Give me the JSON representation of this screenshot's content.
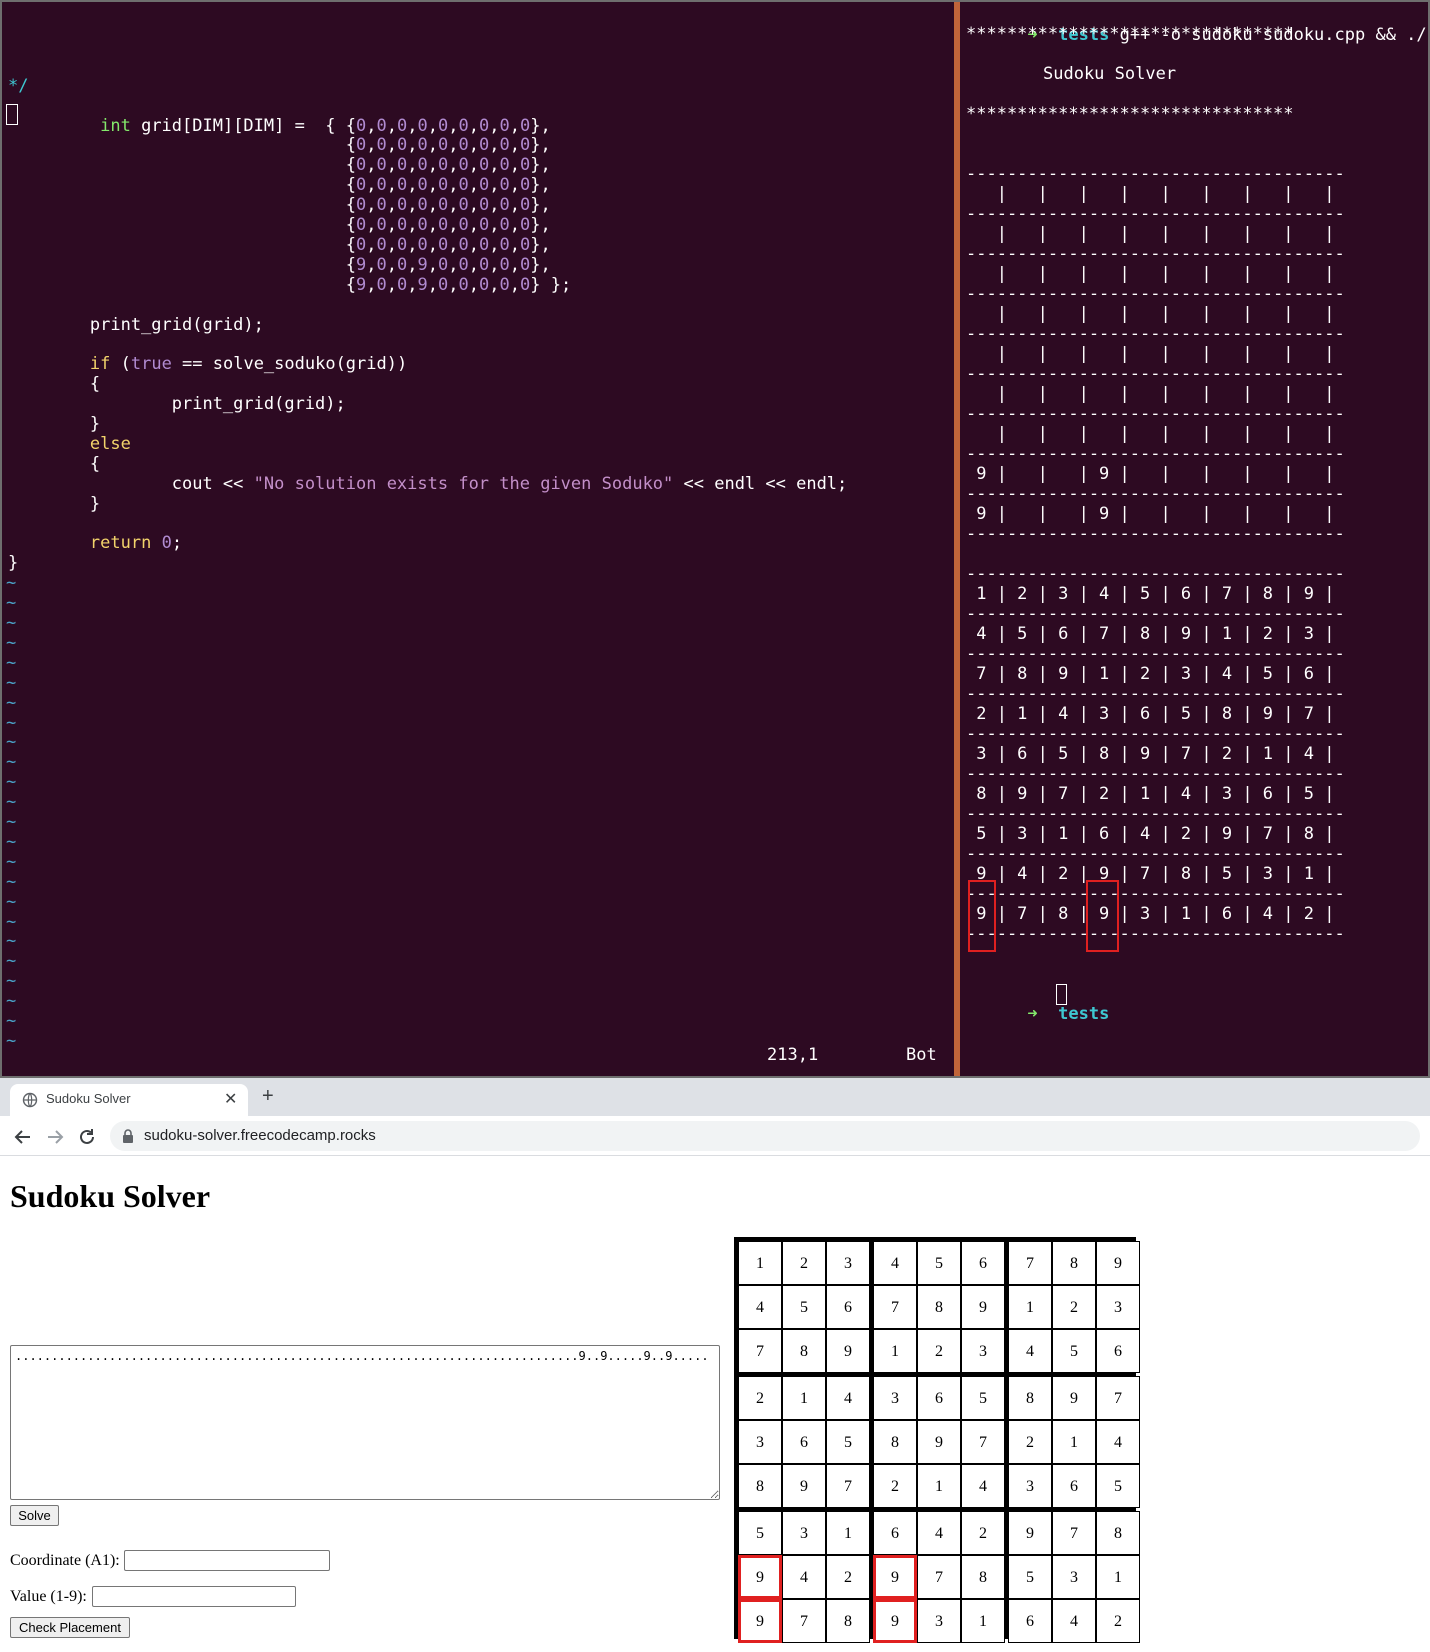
{
  "vim": {
    "lines": [
      [
        {
          "t": "",
          "c": ""
        }
      ],
      [
        {
          "t": "",
          "c": ""
        }
      ],
      [
        {
          "t": "",
          "c": ""
        }
      ],
      [
        {
          "t": "*/",
          "c": "c-cyan"
        }
      ],
      [
        {
          "t": "",
          "c": ""
        }
      ],
      [
        {
          "t": "         ",
          "c": ""
        },
        {
          "t": "int",
          "c": "c-green"
        },
        {
          "t": " grid[DIM][DIM] =  { {",
          "c": ""
        },
        {
          "t": "0",
          "c": "c-num"
        },
        {
          "t": ",",
          "c": ""
        },
        {
          "t": "0",
          "c": "c-num"
        },
        {
          "t": ",",
          "c": ""
        },
        {
          "t": "0",
          "c": "c-num"
        },
        {
          "t": ",",
          "c": ""
        },
        {
          "t": "0",
          "c": "c-num"
        },
        {
          "t": ",",
          "c": ""
        },
        {
          "t": "0",
          "c": "c-num"
        },
        {
          "t": ",",
          "c": ""
        },
        {
          "t": "0",
          "c": "c-num"
        },
        {
          "t": ",",
          "c": ""
        },
        {
          "t": "0",
          "c": "c-num"
        },
        {
          "t": ",",
          "c": ""
        },
        {
          "t": "0",
          "c": "c-num"
        },
        {
          "t": ",",
          "c": ""
        },
        {
          "t": "0",
          "c": "c-num"
        },
        {
          "t": "},",
          "c": ""
        }
      ],
      [
        {
          "t": "                                 {",
          "c": ""
        },
        {
          "t": "0",
          "c": "c-num"
        },
        {
          "t": ",",
          "c": ""
        },
        {
          "t": "0",
          "c": "c-num"
        },
        {
          "t": ",",
          "c": ""
        },
        {
          "t": "0",
          "c": "c-num"
        },
        {
          "t": ",",
          "c": ""
        },
        {
          "t": "0",
          "c": "c-num"
        },
        {
          "t": ",",
          "c": ""
        },
        {
          "t": "0",
          "c": "c-num"
        },
        {
          "t": ",",
          "c": ""
        },
        {
          "t": "0",
          "c": "c-num"
        },
        {
          "t": ",",
          "c": ""
        },
        {
          "t": "0",
          "c": "c-num"
        },
        {
          "t": ",",
          "c": ""
        },
        {
          "t": "0",
          "c": "c-num"
        },
        {
          "t": ",",
          "c": ""
        },
        {
          "t": "0",
          "c": "c-num"
        },
        {
          "t": "},",
          "c": ""
        }
      ],
      [
        {
          "t": "                                 {",
          "c": ""
        },
        {
          "t": "0",
          "c": "c-num"
        },
        {
          "t": ",",
          "c": ""
        },
        {
          "t": "0",
          "c": "c-num"
        },
        {
          "t": ",",
          "c": ""
        },
        {
          "t": "0",
          "c": "c-num"
        },
        {
          "t": ",",
          "c": ""
        },
        {
          "t": "0",
          "c": "c-num"
        },
        {
          "t": ",",
          "c": ""
        },
        {
          "t": "0",
          "c": "c-num"
        },
        {
          "t": ",",
          "c": ""
        },
        {
          "t": "0",
          "c": "c-num"
        },
        {
          "t": ",",
          "c": ""
        },
        {
          "t": "0",
          "c": "c-num"
        },
        {
          "t": ",",
          "c": ""
        },
        {
          "t": "0",
          "c": "c-num"
        },
        {
          "t": ",",
          "c": ""
        },
        {
          "t": "0",
          "c": "c-num"
        },
        {
          "t": "},",
          "c": ""
        }
      ],
      [
        {
          "t": "                                 {",
          "c": ""
        },
        {
          "t": "0",
          "c": "c-num"
        },
        {
          "t": ",",
          "c": ""
        },
        {
          "t": "0",
          "c": "c-num"
        },
        {
          "t": ",",
          "c": ""
        },
        {
          "t": "0",
          "c": "c-num"
        },
        {
          "t": ",",
          "c": ""
        },
        {
          "t": "0",
          "c": "c-num"
        },
        {
          "t": ",",
          "c": ""
        },
        {
          "t": "0",
          "c": "c-num"
        },
        {
          "t": ",",
          "c": ""
        },
        {
          "t": "0",
          "c": "c-num"
        },
        {
          "t": ",",
          "c": ""
        },
        {
          "t": "0",
          "c": "c-num"
        },
        {
          "t": ",",
          "c": ""
        },
        {
          "t": "0",
          "c": "c-num"
        },
        {
          "t": ",",
          "c": ""
        },
        {
          "t": "0",
          "c": "c-num"
        },
        {
          "t": "},",
          "c": ""
        }
      ],
      [
        {
          "t": "                                 {",
          "c": ""
        },
        {
          "t": "0",
          "c": "c-num"
        },
        {
          "t": ",",
          "c": ""
        },
        {
          "t": "0",
          "c": "c-num"
        },
        {
          "t": ",",
          "c": ""
        },
        {
          "t": "0",
          "c": "c-num"
        },
        {
          "t": ",",
          "c": ""
        },
        {
          "t": "0",
          "c": "c-num"
        },
        {
          "t": ",",
          "c": ""
        },
        {
          "t": "0",
          "c": "c-num"
        },
        {
          "t": ",",
          "c": ""
        },
        {
          "t": "0",
          "c": "c-num"
        },
        {
          "t": ",",
          "c": ""
        },
        {
          "t": "0",
          "c": "c-num"
        },
        {
          "t": ",",
          "c": ""
        },
        {
          "t": "0",
          "c": "c-num"
        },
        {
          "t": ",",
          "c": ""
        },
        {
          "t": "0",
          "c": "c-num"
        },
        {
          "t": "},",
          "c": ""
        }
      ],
      [
        {
          "t": "                                 {",
          "c": ""
        },
        {
          "t": "0",
          "c": "c-num"
        },
        {
          "t": ",",
          "c": ""
        },
        {
          "t": "0",
          "c": "c-num"
        },
        {
          "t": ",",
          "c": ""
        },
        {
          "t": "0",
          "c": "c-num"
        },
        {
          "t": ",",
          "c": ""
        },
        {
          "t": "0",
          "c": "c-num"
        },
        {
          "t": ",",
          "c": ""
        },
        {
          "t": "0",
          "c": "c-num"
        },
        {
          "t": ",",
          "c": ""
        },
        {
          "t": "0",
          "c": "c-num"
        },
        {
          "t": ",",
          "c": ""
        },
        {
          "t": "0",
          "c": "c-num"
        },
        {
          "t": ",",
          "c": ""
        },
        {
          "t": "0",
          "c": "c-num"
        },
        {
          "t": ",",
          "c": ""
        },
        {
          "t": "0",
          "c": "c-num"
        },
        {
          "t": "},",
          "c": ""
        }
      ],
      [
        {
          "t": "                                 {",
          "c": ""
        },
        {
          "t": "0",
          "c": "c-num"
        },
        {
          "t": ",",
          "c": ""
        },
        {
          "t": "0",
          "c": "c-num"
        },
        {
          "t": ",",
          "c": ""
        },
        {
          "t": "0",
          "c": "c-num"
        },
        {
          "t": ",",
          "c": ""
        },
        {
          "t": "0",
          "c": "c-num"
        },
        {
          "t": ",",
          "c": ""
        },
        {
          "t": "0",
          "c": "c-num"
        },
        {
          "t": ",",
          "c": ""
        },
        {
          "t": "0",
          "c": "c-num"
        },
        {
          "t": ",",
          "c": ""
        },
        {
          "t": "0",
          "c": "c-num"
        },
        {
          "t": ",",
          "c": ""
        },
        {
          "t": "0",
          "c": "c-num"
        },
        {
          "t": ",",
          "c": ""
        },
        {
          "t": "0",
          "c": "c-num"
        },
        {
          "t": "},",
          "c": ""
        }
      ],
      [
        {
          "t": "                                 {",
          "c": ""
        },
        {
          "t": "9",
          "c": "c-num"
        },
        {
          "t": ",",
          "c": ""
        },
        {
          "t": "0",
          "c": "c-num"
        },
        {
          "t": ",",
          "c": ""
        },
        {
          "t": "0",
          "c": "c-num"
        },
        {
          "t": ",",
          "c": ""
        },
        {
          "t": "9",
          "c": "c-num"
        },
        {
          "t": ",",
          "c": ""
        },
        {
          "t": "0",
          "c": "c-num"
        },
        {
          "t": ",",
          "c": ""
        },
        {
          "t": "0",
          "c": "c-num"
        },
        {
          "t": ",",
          "c": ""
        },
        {
          "t": "0",
          "c": "c-num"
        },
        {
          "t": ",",
          "c": ""
        },
        {
          "t": "0",
          "c": "c-num"
        },
        {
          "t": ",",
          "c": ""
        },
        {
          "t": "0",
          "c": "c-num"
        },
        {
          "t": "},",
          "c": ""
        }
      ],
      [
        {
          "t": "                                 {",
          "c": ""
        },
        {
          "t": "9",
          "c": "c-num"
        },
        {
          "t": ",",
          "c": ""
        },
        {
          "t": "0",
          "c": "c-num"
        },
        {
          "t": ",",
          "c": ""
        },
        {
          "t": "0",
          "c": "c-num"
        },
        {
          "t": ",",
          "c": ""
        },
        {
          "t": "9",
          "c": "c-num"
        },
        {
          "t": ",",
          "c": ""
        },
        {
          "t": "0",
          "c": "c-num"
        },
        {
          "t": ",",
          "c": ""
        },
        {
          "t": "0",
          "c": "c-num"
        },
        {
          "t": ",",
          "c": ""
        },
        {
          "t": "0",
          "c": "c-num"
        },
        {
          "t": ",",
          "c": ""
        },
        {
          "t": "0",
          "c": "c-num"
        },
        {
          "t": ",",
          "c": ""
        },
        {
          "t": "0",
          "c": "c-num"
        },
        {
          "t": "} };",
          "c": ""
        }
      ],
      [
        {
          "t": "",
          "c": ""
        }
      ],
      [
        {
          "t": "        print_grid(grid);",
          "c": ""
        }
      ],
      [
        {
          "t": "",
          "c": ""
        }
      ],
      [
        {
          "t": "        ",
          "c": ""
        },
        {
          "t": "if",
          "c": "c-yellow"
        },
        {
          "t": " (",
          "c": ""
        },
        {
          "t": "true",
          "c": "c-num"
        },
        {
          "t": " == solve_soduko(grid))",
          "c": ""
        }
      ],
      [
        {
          "t": "        {",
          "c": ""
        }
      ],
      [
        {
          "t": "                print_grid(grid);",
          "c": ""
        }
      ],
      [
        {
          "t": "        }",
          "c": ""
        }
      ],
      [
        {
          "t": "        ",
          "c": ""
        },
        {
          "t": "else",
          "c": "c-yellow"
        }
      ],
      [
        {
          "t": "        {",
          "c": ""
        }
      ],
      [
        {
          "t": "                cout << ",
          "c": ""
        },
        {
          "t": "\"No solution exists for the given Soduko\"",
          "c": "c-str"
        },
        {
          "t": " << endl << endl;",
          "c": ""
        }
      ],
      [
        {
          "t": "        }",
          "c": ""
        }
      ],
      [
        {
          "t": "",
          "c": ""
        }
      ],
      [
        {
          "t": "        ",
          "c": ""
        },
        {
          "t": "return",
          "c": "c-yellow"
        },
        {
          "t": " ",
          "c": ""
        },
        {
          "t": "0",
          "c": "c-num"
        },
        {
          "t": ";",
          "c": ""
        }
      ],
      [
        {
          "t": "}",
          "c": ""
        }
      ]
    ],
    "tilde": "~",
    "tilde_count": 24,
    "status_position": "213,1",
    "status_scroll": "Bot"
  },
  "shell": {
    "prompt_arrow": "➜",
    "prompt_dir": "tests",
    "command": "g++ -o sudoku sudoku.cpp && ./sudoku",
    "stars": "********************************",
    "banner": "Sudoku Solver",
    "separator": "-------------------------------------",
    "input_rows": [
      "   |   |   |   |   |   |   |   |   |",
      "   |   |   |   |   |   |   |   |   |",
      "   |   |   |   |   |   |   |   |   |",
      "   |   |   |   |   |   |   |   |   |",
      "   |   |   |   |   |   |   |   |   |",
      "   |   |   |   |   |   |   |   |   |",
      "   |   |   |   |   |   |   |   |   |",
      " 9 |   |   | 9 |   |   |   |   |   |",
      " 9 |   |   | 9 |   |   |   |   |   |"
    ],
    "solved_rows": [
      " 1 | 2 | 3 | 4 | 5 | 6 | 7 | 8 | 9 |",
      " 4 | 5 | 6 | 7 | 8 | 9 | 1 | 2 | 3 |",
      " 7 | 8 | 9 | 1 | 2 | 3 | 4 | 5 | 6 |",
      " 2 | 1 | 4 | 3 | 6 | 5 | 8 | 9 | 7 |",
      " 3 | 6 | 5 | 8 | 9 | 7 | 2 | 1 | 4 |",
      " 8 | 9 | 7 | 2 | 1 | 4 | 3 | 6 | 5 |",
      " 5 | 3 | 1 | 6 | 4 | 2 | 9 | 7 | 8 |",
      " 9 | 4 | 2 | 9 | 7 | 8 | 5 | 3 | 1 |",
      " 9 | 7 | 8 | 9 | 3 | 1 | 6 | 4 | 2 |"
    ]
  },
  "browser": {
    "tab_title": "Sudoku Solver",
    "tab_close": "✕",
    "new_tab": "+",
    "url": "sudoku-solver.freecodecamp.rocks",
    "page_title": "Sudoku Solver",
    "puzzle_string": "..............................................................................9..9.....9..9.....",
    "solve_label": "Solve",
    "coordinate_label": "Coordinate (A1):",
    "value_label": "Value (1-9):",
    "check_label": "Check Placement",
    "grid": [
      [
        1,
        2,
        3,
        4,
        5,
        6,
        7,
        8,
        9
      ],
      [
        4,
        5,
        6,
        7,
        8,
        9,
        1,
        2,
        3
      ],
      [
        7,
        8,
        9,
        1,
        2,
        3,
        4,
        5,
        6
      ],
      [
        2,
        1,
        4,
        3,
        6,
        5,
        8,
        9,
        7
      ],
      [
        3,
        6,
        5,
        8,
        9,
        7,
        2,
        1,
        4
      ],
      [
        8,
        9,
        7,
        2,
        1,
        4,
        3,
        6,
        5
      ],
      [
        5,
        3,
        1,
        6,
        4,
        2,
        9,
        7,
        8
      ],
      [
        9,
        4,
        2,
        9,
        7,
        8,
        5,
        3,
        1
      ],
      [
        9,
        7,
        8,
        9,
        3,
        1,
        6,
        4,
        2
      ]
    ],
    "flagged_cells": [
      [
        7,
        0
      ],
      [
        8,
        0
      ],
      [
        7,
        3
      ],
      [
        8,
        3
      ]
    ],
    "highlight_color": "#e02020"
  }
}
